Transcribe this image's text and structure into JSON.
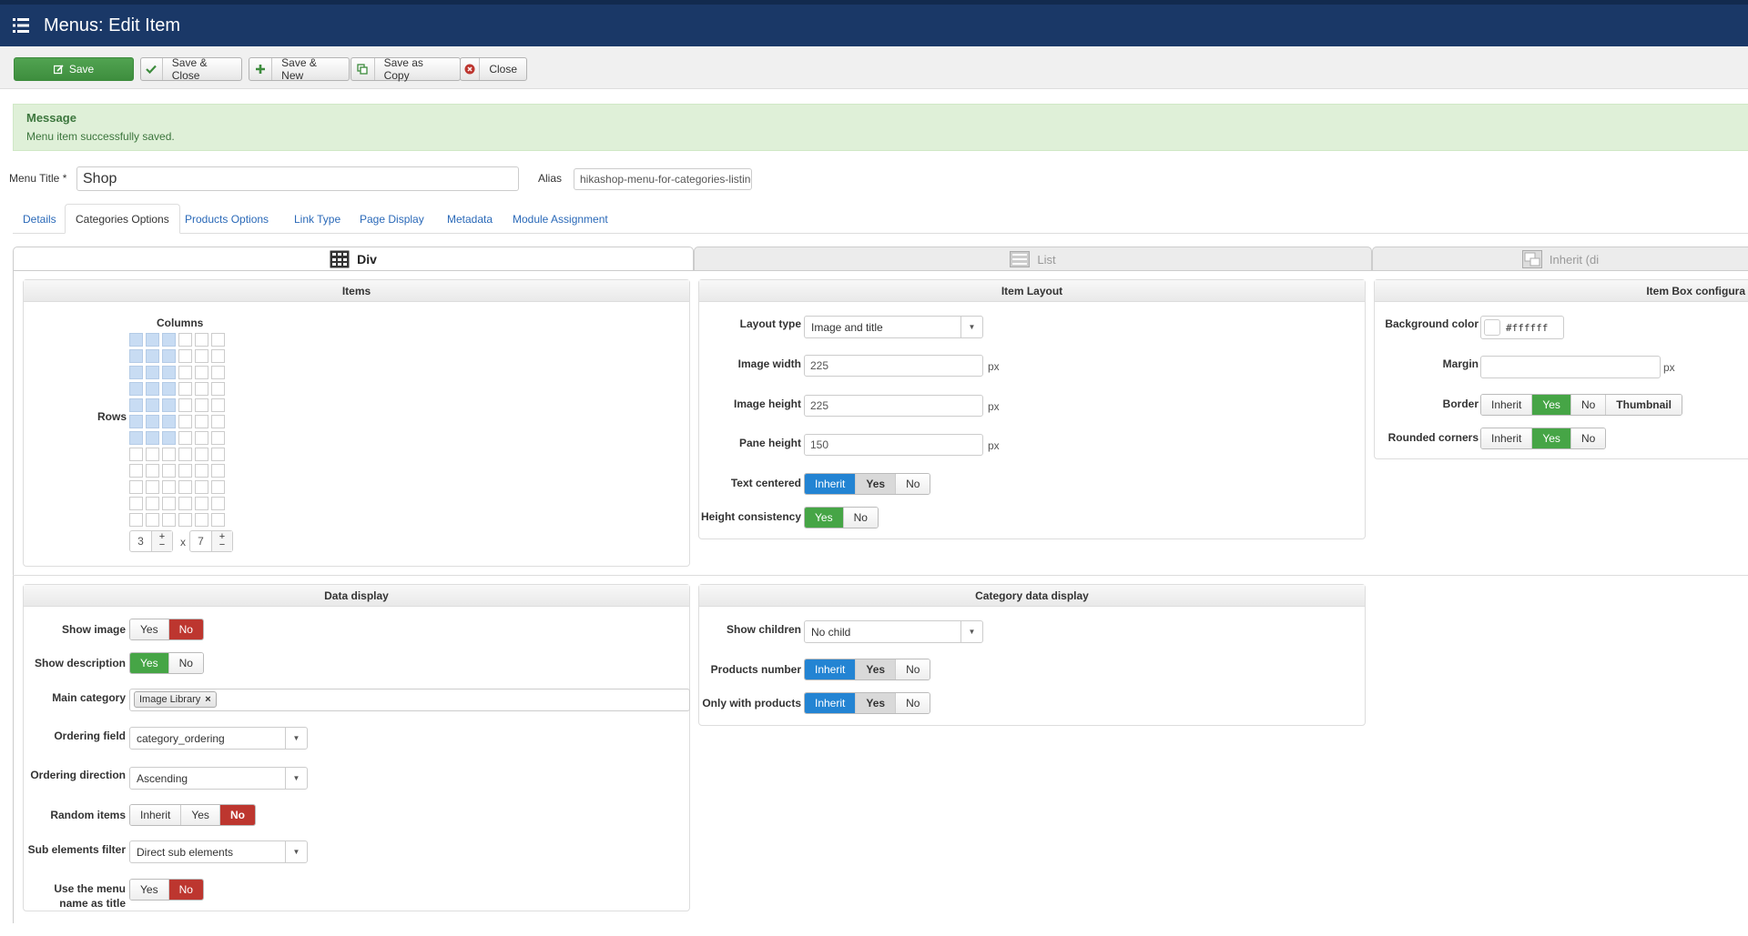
{
  "header": {
    "title": "Menus: Edit Item",
    "menu_icon": "list-icon"
  },
  "toolbar": {
    "save": "Save",
    "save_close": "Save & Close",
    "save_new": "Save & New",
    "save_copy": "Save as Copy",
    "close": "Close"
  },
  "message": {
    "heading": "Message",
    "text": "Menu item successfully saved."
  },
  "form": {
    "menu_title_label": "Menu Title *",
    "menu_title_value": "Shop",
    "alias_label": "Alias",
    "alias_value": "hikashop-menu-for-categories-listing"
  },
  "tabs": [
    "Details",
    "Categories Options",
    "Products Options",
    "Link Type",
    "Page Display",
    "Metadata",
    "Module Assignment"
  ],
  "active_tab": "Categories Options",
  "layout_tabs": {
    "div": "Div",
    "list": "List",
    "inherit": "Inherit (di"
  },
  "items_panel": {
    "title": "Items",
    "columns_label": "Columns",
    "rows_label": "Rows",
    "columns": "3",
    "rows": "7",
    "times": "x",
    "grid_cols": 6,
    "grid_rows": 12,
    "plus": "+",
    "minus": "−"
  },
  "item_layout": {
    "title": "Item Layout",
    "layout_type_label": "Layout type",
    "layout_type_value": "Image and title",
    "image_width_label": "Image width",
    "image_width_value": "225",
    "image_height_label": "Image height",
    "image_height_value": "225",
    "pane_height_label": "Pane height",
    "pane_height_value": "150",
    "unit": "px",
    "text_centered_label": "Text centered",
    "height_consistency_label": "Height consistency"
  },
  "item_box": {
    "title": "Item Box configura",
    "bg_color_label": "Background color",
    "bg_color_value": "#ffffff",
    "margin_label": "Margin",
    "margin_value": "",
    "unit": "px",
    "border_label": "Border",
    "rounded_label": "Rounded corners"
  },
  "data_display": {
    "title": "Data display",
    "show_image_label": "Show image",
    "show_description_label": "Show description",
    "main_category_label": "Main category",
    "main_category_tag": "Image Library",
    "tag_remove": "×",
    "ordering_field_label": "Ordering field",
    "ordering_field_value": "category_ordering",
    "ordering_direction_label": "Ordering direction",
    "ordering_direction_value": "Ascending",
    "random_items_label": "Random items",
    "sub_filter_label": "Sub elements filter",
    "sub_filter_value": "Direct sub elements",
    "use_menu_name_label_1": "Use the menu",
    "use_menu_name_label_2": "name as title"
  },
  "category_display": {
    "title": "Category data display",
    "show_children_label": "Show children",
    "show_children_value": "No child",
    "products_number_label": "Products number",
    "only_with_products_label": "Only with products"
  },
  "opts": {
    "inherit": "Inherit",
    "yes": "Yes",
    "no": "No",
    "thumbnail": "Thumbnail"
  },
  "colors": {
    "header": "#1a3867",
    "save_green": "#46a546",
    "active_blue": "#2384d3",
    "no_red": "#bd362f",
    "alert_bg": "#dff0d8"
  }
}
